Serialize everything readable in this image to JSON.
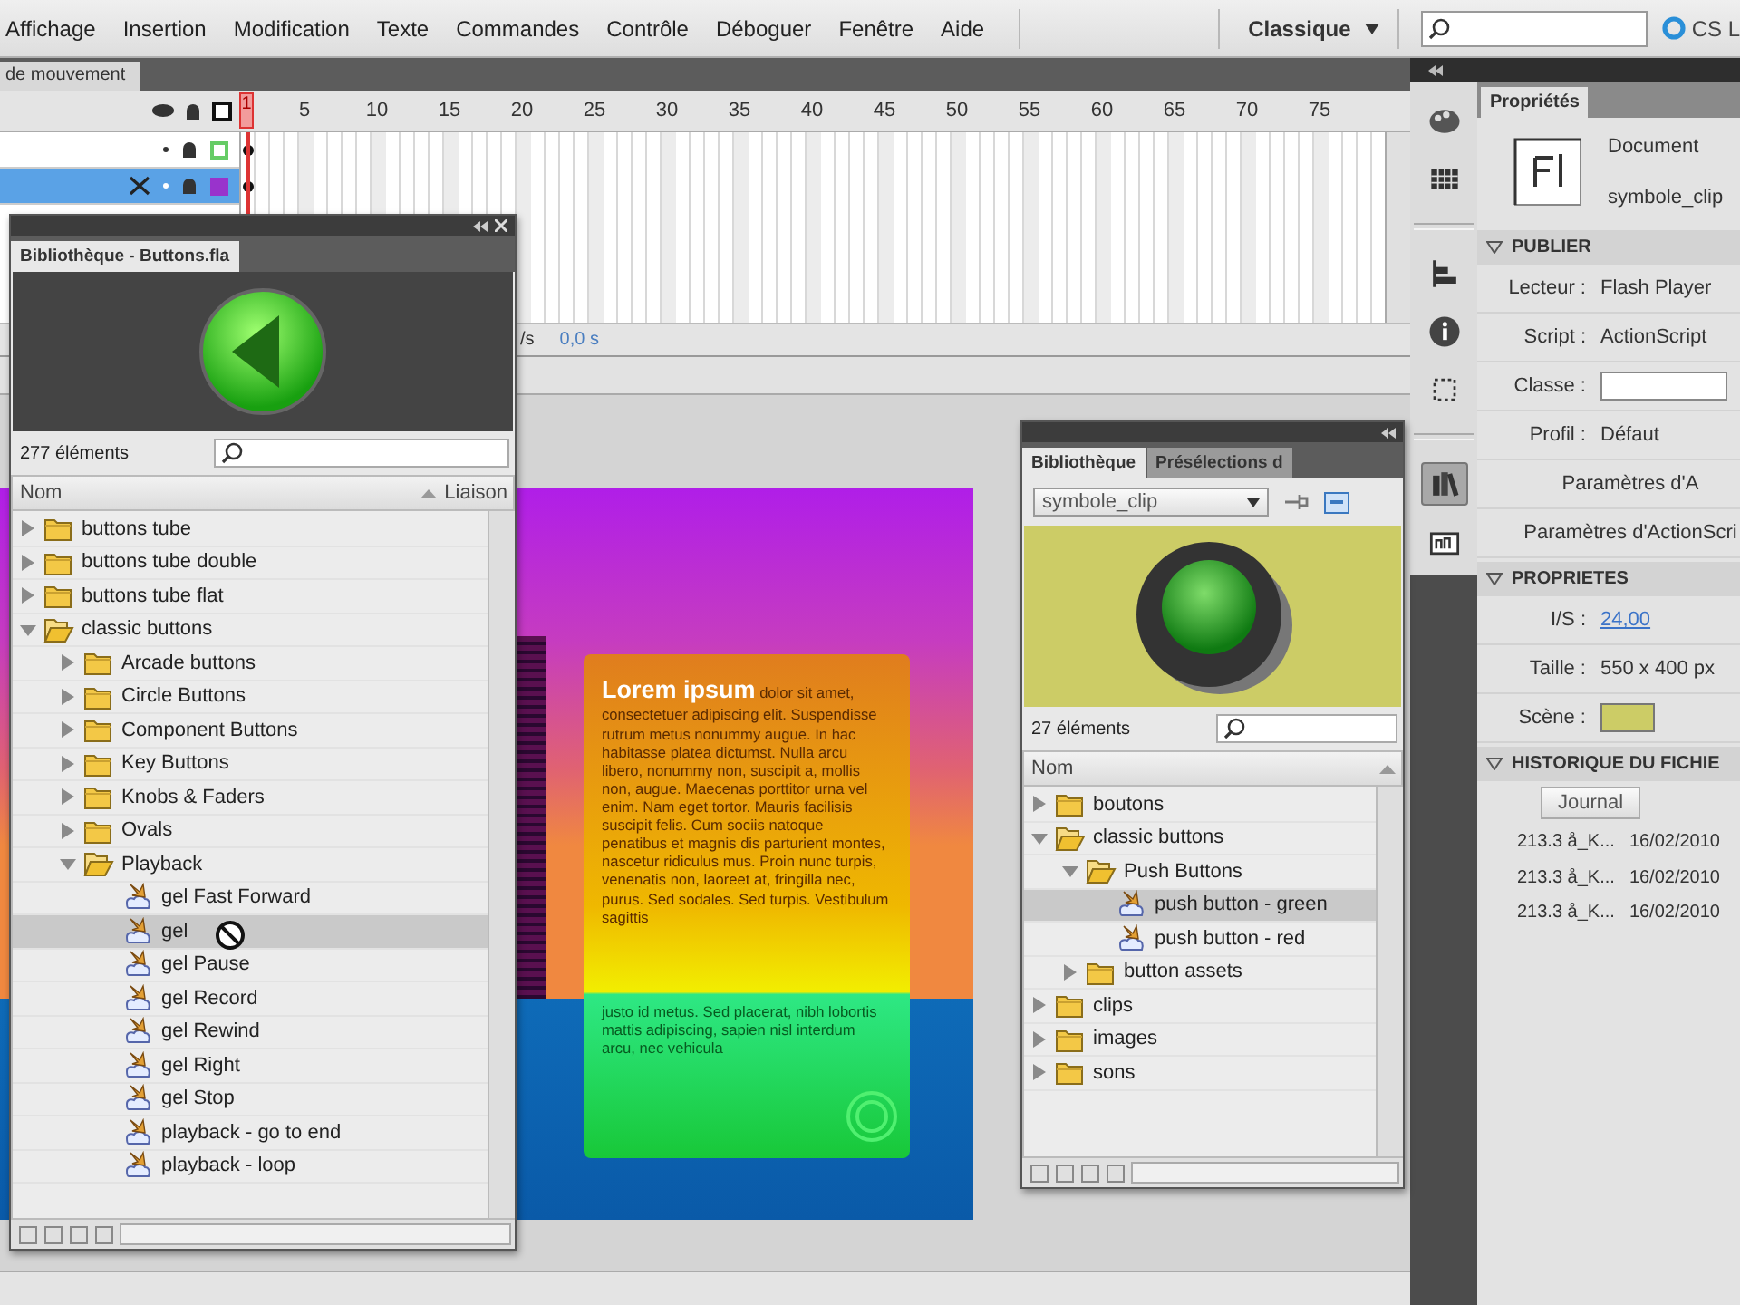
{
  "menu": {
    "items": [
      "Affichage",
      "Insertion",
      "Modification",
      "Texte",
      "Commandes",
      "Contrôle",
      "Déboguer",
      "Fenêtre",
      "Aide"
    ],
    "workspace": "Classique",
    "brand": "CS L"
  },
  "timeline": {
    "tab": "de mouvement",
    "frame_labels": [
      "1",
      "5",
      "10",
      "15",
      "20",
      "25",
      "30",
      "35",
      "40",
      "45",
      "50",
      "55",
      "60",
      "65",
      "70",
      "75"
    ],
    "layers": [
      {
        "selected": false,
        "outline": true,
        "color": "#66cc66"
      },
      {
        "selected": true,
        "outline": false,
        "color": "#9933cc"
      }
    ],
    "status": [
      "/s",
      "0,0 s"
    ]
  },
  "stage": {
    "text": "**Lorem ipsum** dolor sit amet, consectetuer adipiscing elit. Suspendisse rutrum metus nonummy augue. In hac habitasse platea dictumst. Nulla arcu libero, nonummy non, suscipit a, mollis non, augue. Maecenas porttitor urna vel enim. Nam eget tortor. Mauris facilisis suscipit felis. Cum sociis natoque penatibus et magnis dis parturient montes, nascetur ridiculus mus. Proin nunc turpis, venenatis non, laoreet at, fringilla nec, purus. Sed sodales. Sed turpis. Vestibulum sagittis",
    "text_2": "justo id metus. Sed placerat, nibh lobortis mattis adipiscing, sapien nisl interdum arcu, nec vehicula"
  },
  "library_main": {
    "title": "Bibliothèque - Buttons.fla",
    "preview": {
      "kind": "arrow-ball"
    },
    "count": "277 éléments",
    "columns": [
      "Nom",
      "Liaison"
    ],
    "items": [
      {
        "label": "buttons tube",
        "kind": "folder",
        "expanded": false,
        "selected": false
      },
      {
        "label": "buttons tube double",
        "kind": "folder",
        "expanded": false,
        "selected": false
      },
      {
        "label": "buttons tube flat",
        "kind": "folder",
        "expanded": false,
        "selected": false
      },
      {
        "label": "classic buttons",
        "kind": "folder",
        "expanded": true,
        "selected": false,
        "children": [
          {
            "label": "Arcade buttons",
            "kind": "folder",
            "expanded": false,
            "selected": false
          },
          {
            "label": "Circle Buttons",
            "kind": "folder",
            "expanded": false,
            "selected": false
          },
          {
            "label": "Component Buttons",
            "kind": "folder",
            "expanded": false,
            "selected": false
          },
          {
            "label": "Key Buttons",
            "kind": "folder",
            "expanded": false,
            "selected": false
          },
          {
            "label": "Knobs & Faders",
            "kind": "folder",
            "expanded": false,
            "selected": false
          },
          {
            "label": "Ovals",
            "kind": "folder",
            "expanded": false,
            "selected": false
          },
          {
            "label": "Playback",
            "kind": "folder",
            "expanded": true,
            "selected": false,
            "children": [
              {
                "label": "gel Fast Forward",
                "kind": "symbol",
                "selected": false
              },
              {
                "label": "gel",
                "kind": "symbol",
                "selected": true
              },
              {
                "label": "gel Pause",
                "kind": "symbol",
                "selected": false
              },
              {
                "label": "gel Record",
                "kind": "symbol",
                "selected": false
              },
              {
                "label": "gel Rewind",
                "kind": "symbol",
                "selected": false
              },
              {
                "label": "gel Right",
                "kind": "symbol",
                "selected": false
              },
              {
                "label": "gel Stop",
                "kind": "symbol",
                "selected": false
              },
              {
                "label": "playback - go to end",
                "kind": "symbol",
                "selected": false
              },
              {
                "label": "playback - loop",
                "kind": "symbol",
                "selected": false
              }
            ]
          }
        ]
      }
    ]
  },
  "library_docked": {
    "tabs": [
      {
        "label": "Bibliothèque",
        "selected": true
      },
      {
        "label": "Présélections d",
        "selected": false
      }
    ],
    "symbol": "symbole_clip",
    "preview": {
      "kind": "push-button"
    },
    "count": "27 éléments",
    "columns": [
      "Nom"
    ],
    "items": [
      {
        "label": "boutons",
        "kind": "folder",
        "expanded": false,
        "selected": false
      },
      {
        "label": "classic buttons",
        "kind": "folder",
        "expanded": true,
        "selected": false,
        "children": [
          {
            "label": "Push Buttons",
            "kind": "folder",
            "expanded": true,
            "selected": false,
            "children": [
              {
                "label": "push button - green",
                "kind": "symbol",
                "selected": true
              },
              {
                "label": "push button - red",
                "kind": "symbol",
                "selected": false
              }
            ]
          },
          {
            "label": "button assets",
            "kind": "folder",
            "expanded": false,
            "selected": false
          }
        ]
      },
      {
        "label": "clips",
        "kind": "folder",
        "expanded": false,
        "selected": false
      },
      {
        "label": "images",
        "kind": "folder",
        "expanded": false,
        "selected": false
      },
      {
        "label": "sons",
        "kind": "folder",
        "expanded": false,
        "selected": false
      }
    ]
  },
  "toolbar": [
    {
      "selected": false
    },
    {
      "selected": false
    },
    {
      "selected": false
    },
    {
      "selected": false
    },
    {
      "selected": false
    },
    {
      "selected": true
    },
    {
      "selected": false
    }
  ],
  "properties": {
    "tab": "Propriétés",
    "doc_type": "Document",
    "doc_name": "symbole_clip",
    "sections": [
      {
        "title": "PUBLIER",
        "expanded": true,
        "rows": [
          {
            "kind": "value",
            "label": "Lecteur :",
            "value": "Flash Player"
          },
          {
            "kind": "value",
            "label": "Script :",
            "value": "ActionScript"
          },
          {
            "kind": "input",
            "label": "Classe :"
          },
          {
            "kind": "value",
            "label": "Profil :",
            "value": "Défaut"
          },
          {
            "kind": "center",
            "value": "Paramètres d'A"
          },
          {
            "kind": "center",
            "value": "Paramètres d'ActionScri"
          }
        ]
      },
      {
        "title": "PROPRIETES",
        "expanded": true,
        "rows": [
          {
            "kind": "link",
            "label": "I/S :",
            "value": "24,00"
          },
          {
            "kind": "value",
            "label": "Taille :",
            "value": "550 x 400 px"
          },
          {
            "kind": "swatch",
            "label": "Scène :",
            "color": "#cccc66"
          }
        ]
      },
      {
        "title": "HISTORIQUE DU FICHIE",
        "expanded": true,
        "rows": [
          {
            "kind": "button",
            "value": "Journal"
          },
          {
            "kind": "history",
            "value": "213.3 å_K...",
            "date": "16/02/2010"
          },
          {
            "kind": "history",
            "value": "213.3 å_K...",
            "date": "16/02/2010"
          },
          {
            "kind": "history",
            "value": "213.3 å_K...",
            "date": "16/02/2010"
          }
        ]
      }
    ]
  }
}
